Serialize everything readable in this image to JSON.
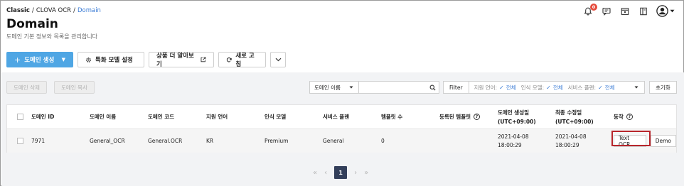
{
  "breadcrumb": {
    "root": "Classic",
    "sep1": "/",
    "parent": "CLOVA OCR",
    "sep2": "/",
    "current": "Domain"
  },
  "page": {
    "title": "Domain",
    "subtitle": "도메인 기본 정보와 목록을 관리합니다"
  },
  "header_icons": {
    "notification_count": "0",
    "icons": [
      "bell-icon",
      "chat-icon",
      "calendar-icon",
      "book-icon",
      "user-avatar-icon",
      "caret-down-icon"
    ]
  },
  "toolbar": {
    "create_label": "도메인 생성",
    "create_plus": "+",
    "create_caret": "▼",
    "special_model_label": "특화 모델 설정",
    "learn_more_label": "상품 더 알아보기",
    "refresh_label": "새로 고침"
  },
  "filters": {
    "delete_label": "도메인 삭제",
    "copy_label": "도메인 복사",
    "search_field_select": "도메인 이름",
    "search_placeholder": "",
    "filter_label": "Filter",
    "lang_label": "지원 언어:",
    "lang_value": "전체",
    "model_label": "인식 모델:",
    "model_value": "전체",
    "plan_label": "서비스 플랜:",
    "plan_value": "전체",
    "check_glyph": "✓",
    "reset_label": "초기화"
  },
  "table": {
    "headers": {
      "id": "도메인 ID",
      "name": "도메인 이름",
      "code": "도메인 코드",
      "lang": "지원 언어",
      "model": "인식 모델",
      "plan": "서비스 플랜",
      "template_count": "템플릿 수",
      "registered_template": "등록된 템플릿",
      "created_line1": "도메인 생성일",
      "created_line2": "(UTC+09:00)",
      "modified_line1": "최종 수정일",
      "modified_line2": "(UTC+09:00)",
      "action": "동작"
    },
    "rows": [
      {
        "id": "7971",
        "name": "General_OCR",
        "code": "General.OCR",
        "lang": "KR",
        "model": "Premium",
        "plan": "General",
        "template_count": "0",
        "registered_template": "",
        "created_date": "2021-04-08",
        "created_time": "18:00:29",
        "modified_date": "2021-04-08",
        "modified_time": "18:00:29",
        "action_text_ocr": "Text OCR",
        "action_demo": "Demo"
      }
    ]
  },
  "pagination": {
    "first": "«",
    "prev": "‹",
    "current": "1",
    "next": "›",
    "last": "»"
  },
  "colors": {
    "primary": "#4fa6e4",
    "link": "#3a7bd5",
    "highlight": "#b8262c",
    "badge": "#e54b3c",
    "page_current": "#333f5a"
  }
}
